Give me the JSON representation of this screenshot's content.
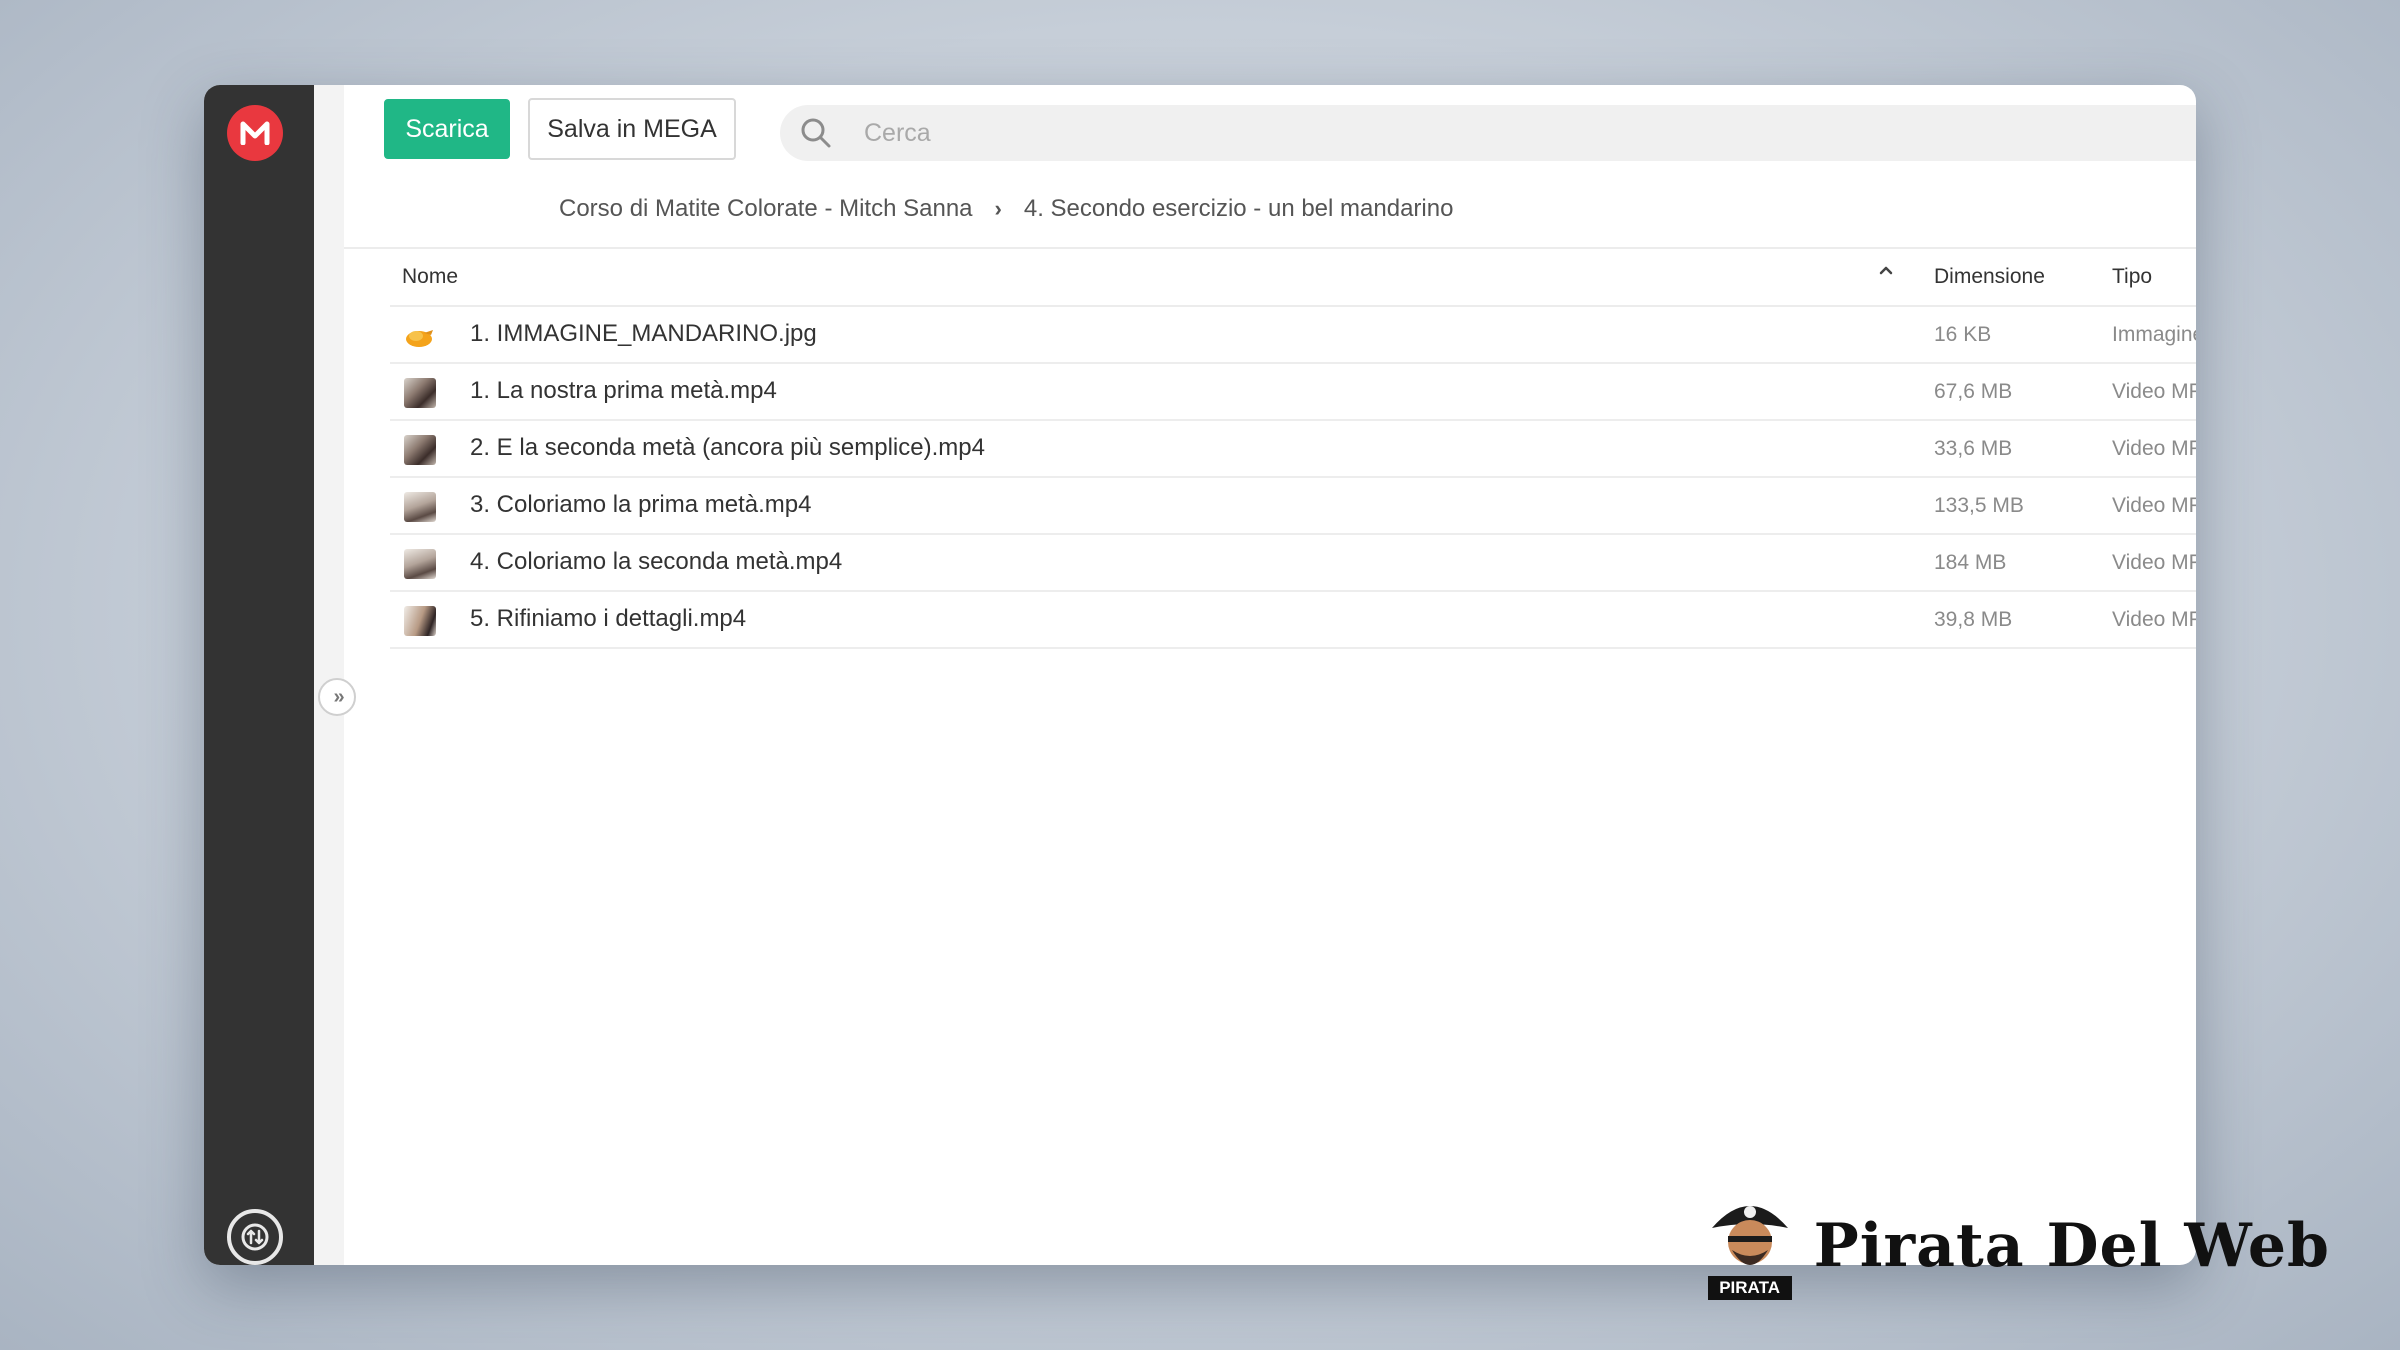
{
  "toolbar": {
    "download_label": "Scarica",
    "save_label": "Salva in MEGA"
  },
  "search": {
    "placeholder": "Cerca"
  },
  "breadcrumb": {
    "items": [
      "Corso di Matite Colorate - Mitch Sanna",
      "4. Secondo esercizio - un bel mandarino"
    ]
  },
  "table": {
    "columns": {
      "name": "Nome",
      "size": "Dimensione",
      "type": "Tipo"
    },
    "rows": [
      {
        "name": "1. IMMAGINE_MANDARINO.jpg",
        "size": "16 KB",
        "type": "Immagine JPE",
        "icon": "image-thumbnail-icon"
      },
      {
        "name": "1. La nostra prima metà.mp4",
        "size": "67,6 MB",
        "type": "Video MPEG-",
        "icon": "video-thumbnail-icon"
      },
      {
        "name": "2. E la seconda metà (ancora più semplice).mp4",
        "size": "33,6 MB",
        "type": "Video MPEG-",
        "icon": "video-thumbnail-icon"
      },
      {
        "name": "3. Coloriamo la prima metà.mp4",
        "size": "133,5 MB",
        "type": "Video MPEG-",
        "icon": "video-thumbnail-icon"
      },
      {
        "name": "4. Coloriamo la seconda metà.mp4",
        "size": "184 MB",
        "type": "Video MPEG-",
        "icon": "video-thumbnail-icon"
      },
      {
        "name": "5. Rifiniamo i dettagli.mp4",
        "size": "39,8 MB",
        "type": "Video MPEG-",
        "icon": "video-thumbnail-icon"
      }
    ]
  },
  "watermark": {
    "text": "Pirata Del Web",
    "badge_label": "PIRATA"
  },
  "colors": {
    "brand_red": "#e9383f",
    "accent_green": "#20b786",
    "sidebar": "#333333"
  }
}
